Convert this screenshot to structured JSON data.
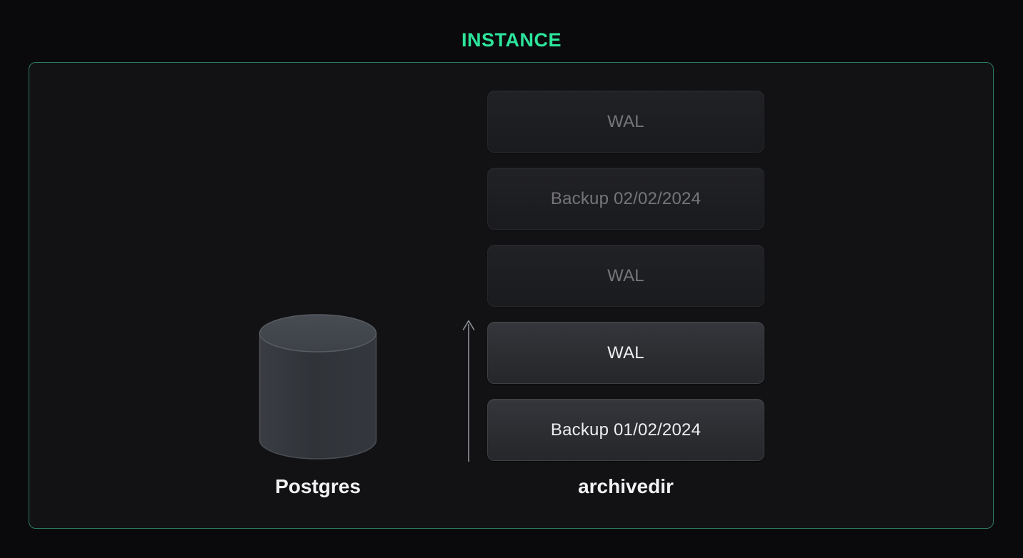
{
  "instance": {
    "title": "INSTANCE"
  },
  "postgres": {
    "label": "Postgres",
    "icon": "database-cylinder-icon"
  },
  "archivedir": {
    "label": "archivedir",
    "arrow_icon": "upward-arrow-icon",
    "items": [
      {
        "label": "WAL",
        "state": "faded"
      },
      {
        "label": "Backup 02/02/2024",
        "state": "faded"
      },
      {
        "label": "WAL",
        "state": "faded"
      },
      {
        "label": "WAL",
        "state": "bright"
      },
      {
        "label": "Backup 01/02/2024",
        "state": "bright"
      }
    ]
  },
  "colors": {
    "accent_green": "#2ce49b",
    "panel_border_green": "#2e7d5e",
    "page_background": "#0a0a0c",
    "panel_background": "#121214",
    "box_text": "#ededef",
    "arrow_gray": "#8e9196",
    "label_text": "#f2f2f3"
  }
}
